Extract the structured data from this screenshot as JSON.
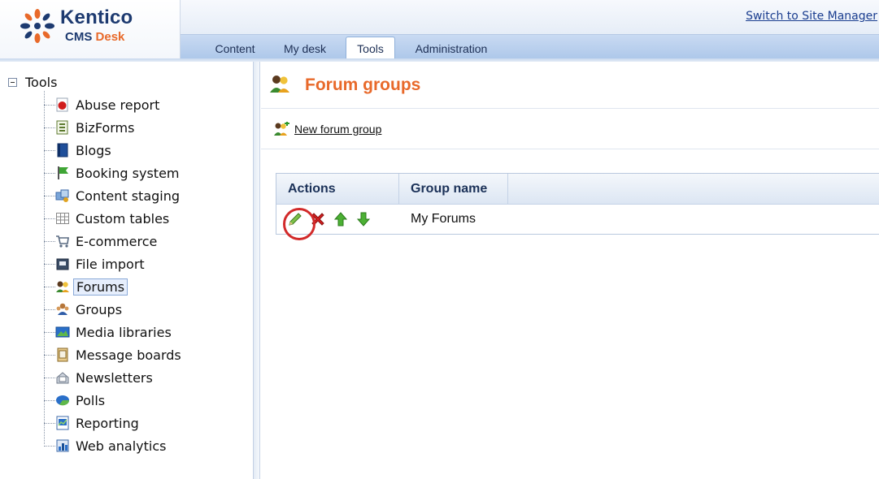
{
  "app": {
    "brand": "Kentico",
    "product": "CMS",
    "product_accent": "Desk"
  },
  "header": {
    "switch_link": "Switch to Site Manager",
    "tabs": [
      {
        "label": "Content",
        "active": false
      },
      {
        "label": "My desk",
        "active": false
      },
      {
        "label": "Tools",
        "active": true
      },
      {
        "label": "Administration",
        "active": false
      }
    ]
  },
  "sidebar": {
    "root_label": "Tools",
    "items": [
      {
        "label": "Abuse report",
        "icon": "abuse-report-icon",
        "selected": false
      },
      {
        "label": "BizForms",
        "icon": "bizforms-icon",
        "selected": false
      },
      {
        "label": "Blogs",
        "icon": "blogs-icon",
        "selected": false
      },
      {
        "label": "Booking system",
        "icon": "booking-system-icon",
        "selected": false
      },
      {
        "label": "Content staging",
        "icon": "content-staging-icon",
        "selected": false
      },
      {
        "label": "Custom tables",
        "icon": "custom-tables-icon",
        "selected": false
      },
      {
        "label": "E-commerce",
        "icon": "ecommerce-icon",
        "selected": false
      },
      {
        "label": "File import",
        "icon": "file-import-icon",
        "selected": false
      },
      {
        "label": "Forums",
        "icon": "forums-icon",
        "selected": true
      },
      {
        "label": "Groups",
        "icon": "groups-icon",
        "selected": false
      },
      {
        "label": "Media libraries",
        "icon": "media-libraries-icon",
        "selected": false
      },
      {
        "label": "Message boards",
        "icon": "message-boards-icon",
        "selected": false
      },
      {
        "label": "Newsletters",
        "icon": "newsletters-icon",
        "selected": false
      },
      {
        "label": "Polls",
        "icon": "polls-icon",
        "selected": false
      },
      {
        "label": "Reporting",
        "icon": "reporting-icon",
        "selected": false
      },
      {
        "label": "Web analytics",
        "icon": "web-analytics-icon",
        "selected": false
      }
    ]
  },
  "main": {
    "title": "Forum groups",
    "new_link": "New forum group",
    "grid": {
      "columns": [
        "Actions",
        "Group name"
      ],
      "rows": [
        {
          "group_name": "My Forums"
        }
      ]
    }
  },
  "colors": {
    "accent_orange": "#e8692a",
    "brand_navy": "#1d3a70",
    "highlight_red": "#d22a2a"
  }
}
